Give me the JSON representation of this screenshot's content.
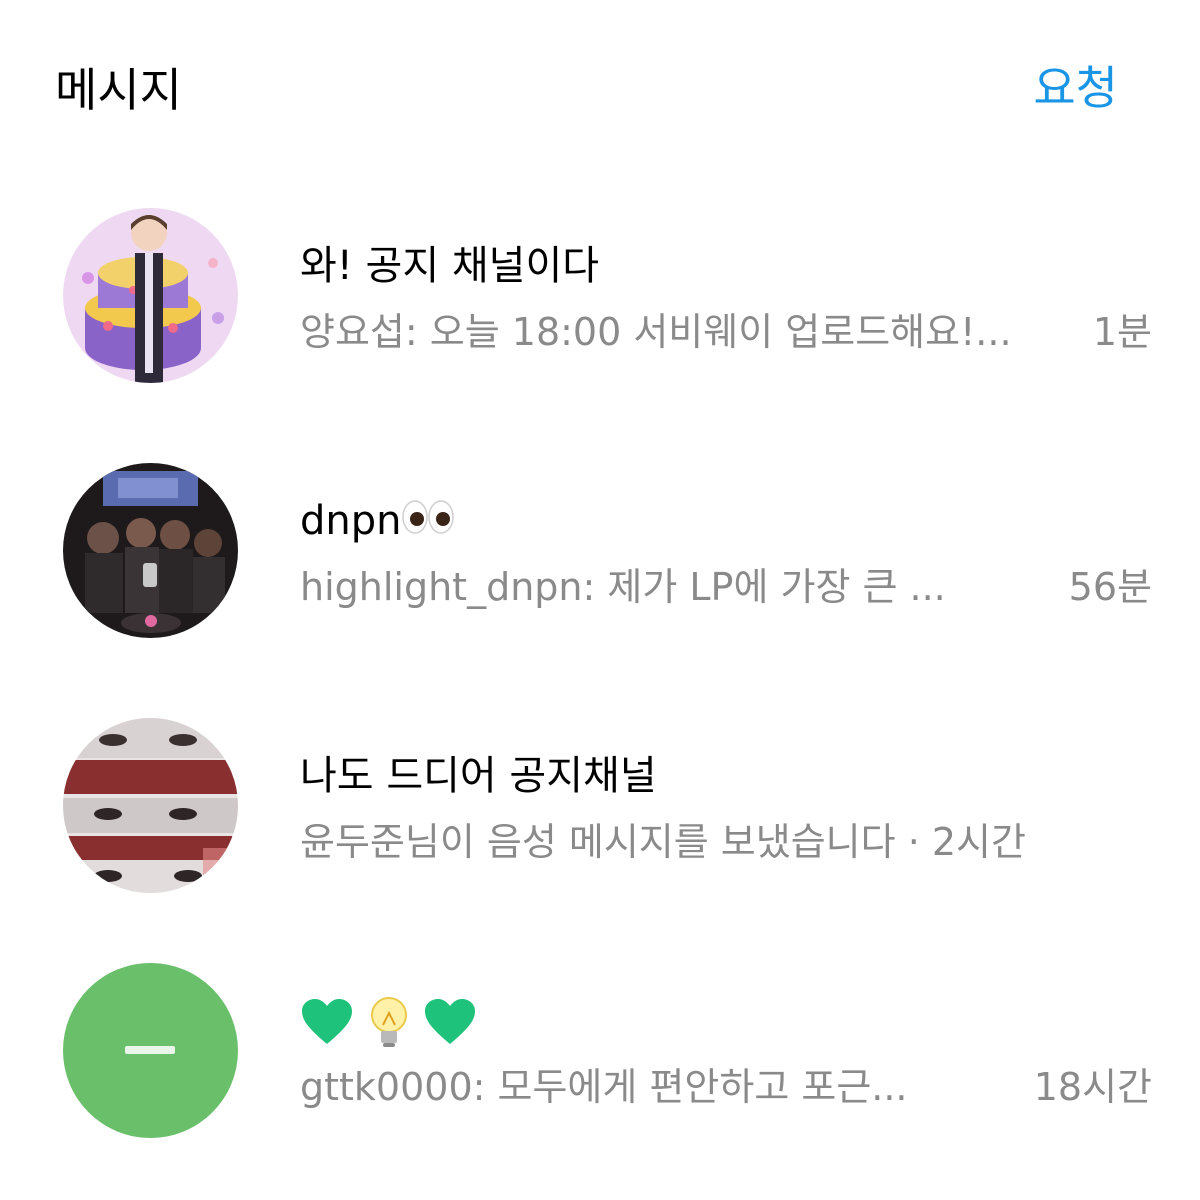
{
  "header": {
    "title": "메시지",
    "requests_label": "요청"
  },
  "colors": {
    "accent": "#1a95e6",
    "secondary_text": "#8a8a8a"
  },
  "threads": [
    {
      "name": "와! 공지 채널이다",
      "preview": "양요섭: 오늘 18:00 서비웨이 업로드해요!...",
      "time": "1분",
      "avatar_icon": "person-with-birthday-cake-avatar"
    },
    {
      "name": "dnpn",
      "name_emoji": "eyes",
      "preview": "highlight_dnpn: 제가 LP에 가장 큰 ...",
      "time": "56분",
      "avatar_icon": "group-photo-avatar"
    },
    {
      "name": "나도 드디어 공지채널",
      "preview": "윤두준님이 음성 메시지를 보냈습니다",
      "separator": " · ",
      "time": "2시간",
      "avatar_icon": "album-art-avatar"
    },
    {
      "name_emojis": [
        "green-heart",
        "light-bulb",
        "green-heart"
      ],
      "preview": "gttk0000: 모두에게 편안하고 포근...",
      "time": "18시간",
      "avatar_icon": "green-circle-avatar"
    }
  ]
}
